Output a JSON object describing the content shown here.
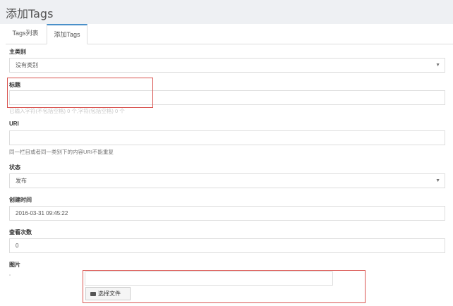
{
  "header": {
    "title": "添加Tags"
  },
  "tabs": [
    {
      "label": "Tags列表"
    },
    {
      "label": "添加Tags"
    }
  ],
  "form": {
    "category": {
      "label": "主类别",
      "value": "没有类别"
    },
    "title": {
      "label": "标题",
      "value": "",
      "help": "已输入字符(不包括空格) 0 个,字符(包括空格) 0 个"
    },
    "uri": {
      "label": "URI",
      "value": "",
      "help": "同一栏目或者同一类别下的内容URI不能重复"
    },
    "status": {
      "label": "状态",
      "value": "发布"
    },
    "created_at": {
      "label": "创建时间",
      "value": "2016-03-31 09:45:22"
    },
    "views": {
      "label": "查看次数",
      "value": "0"
    },
    "image": {
      "label": "图片",
      "file_button": "选择文件",
      "file_icon": "folder-open-icon"
    }
  },
  "colors": {
    "accent": "#4a90c9",
    "highlight_box": "#d9534f"
  }
}
